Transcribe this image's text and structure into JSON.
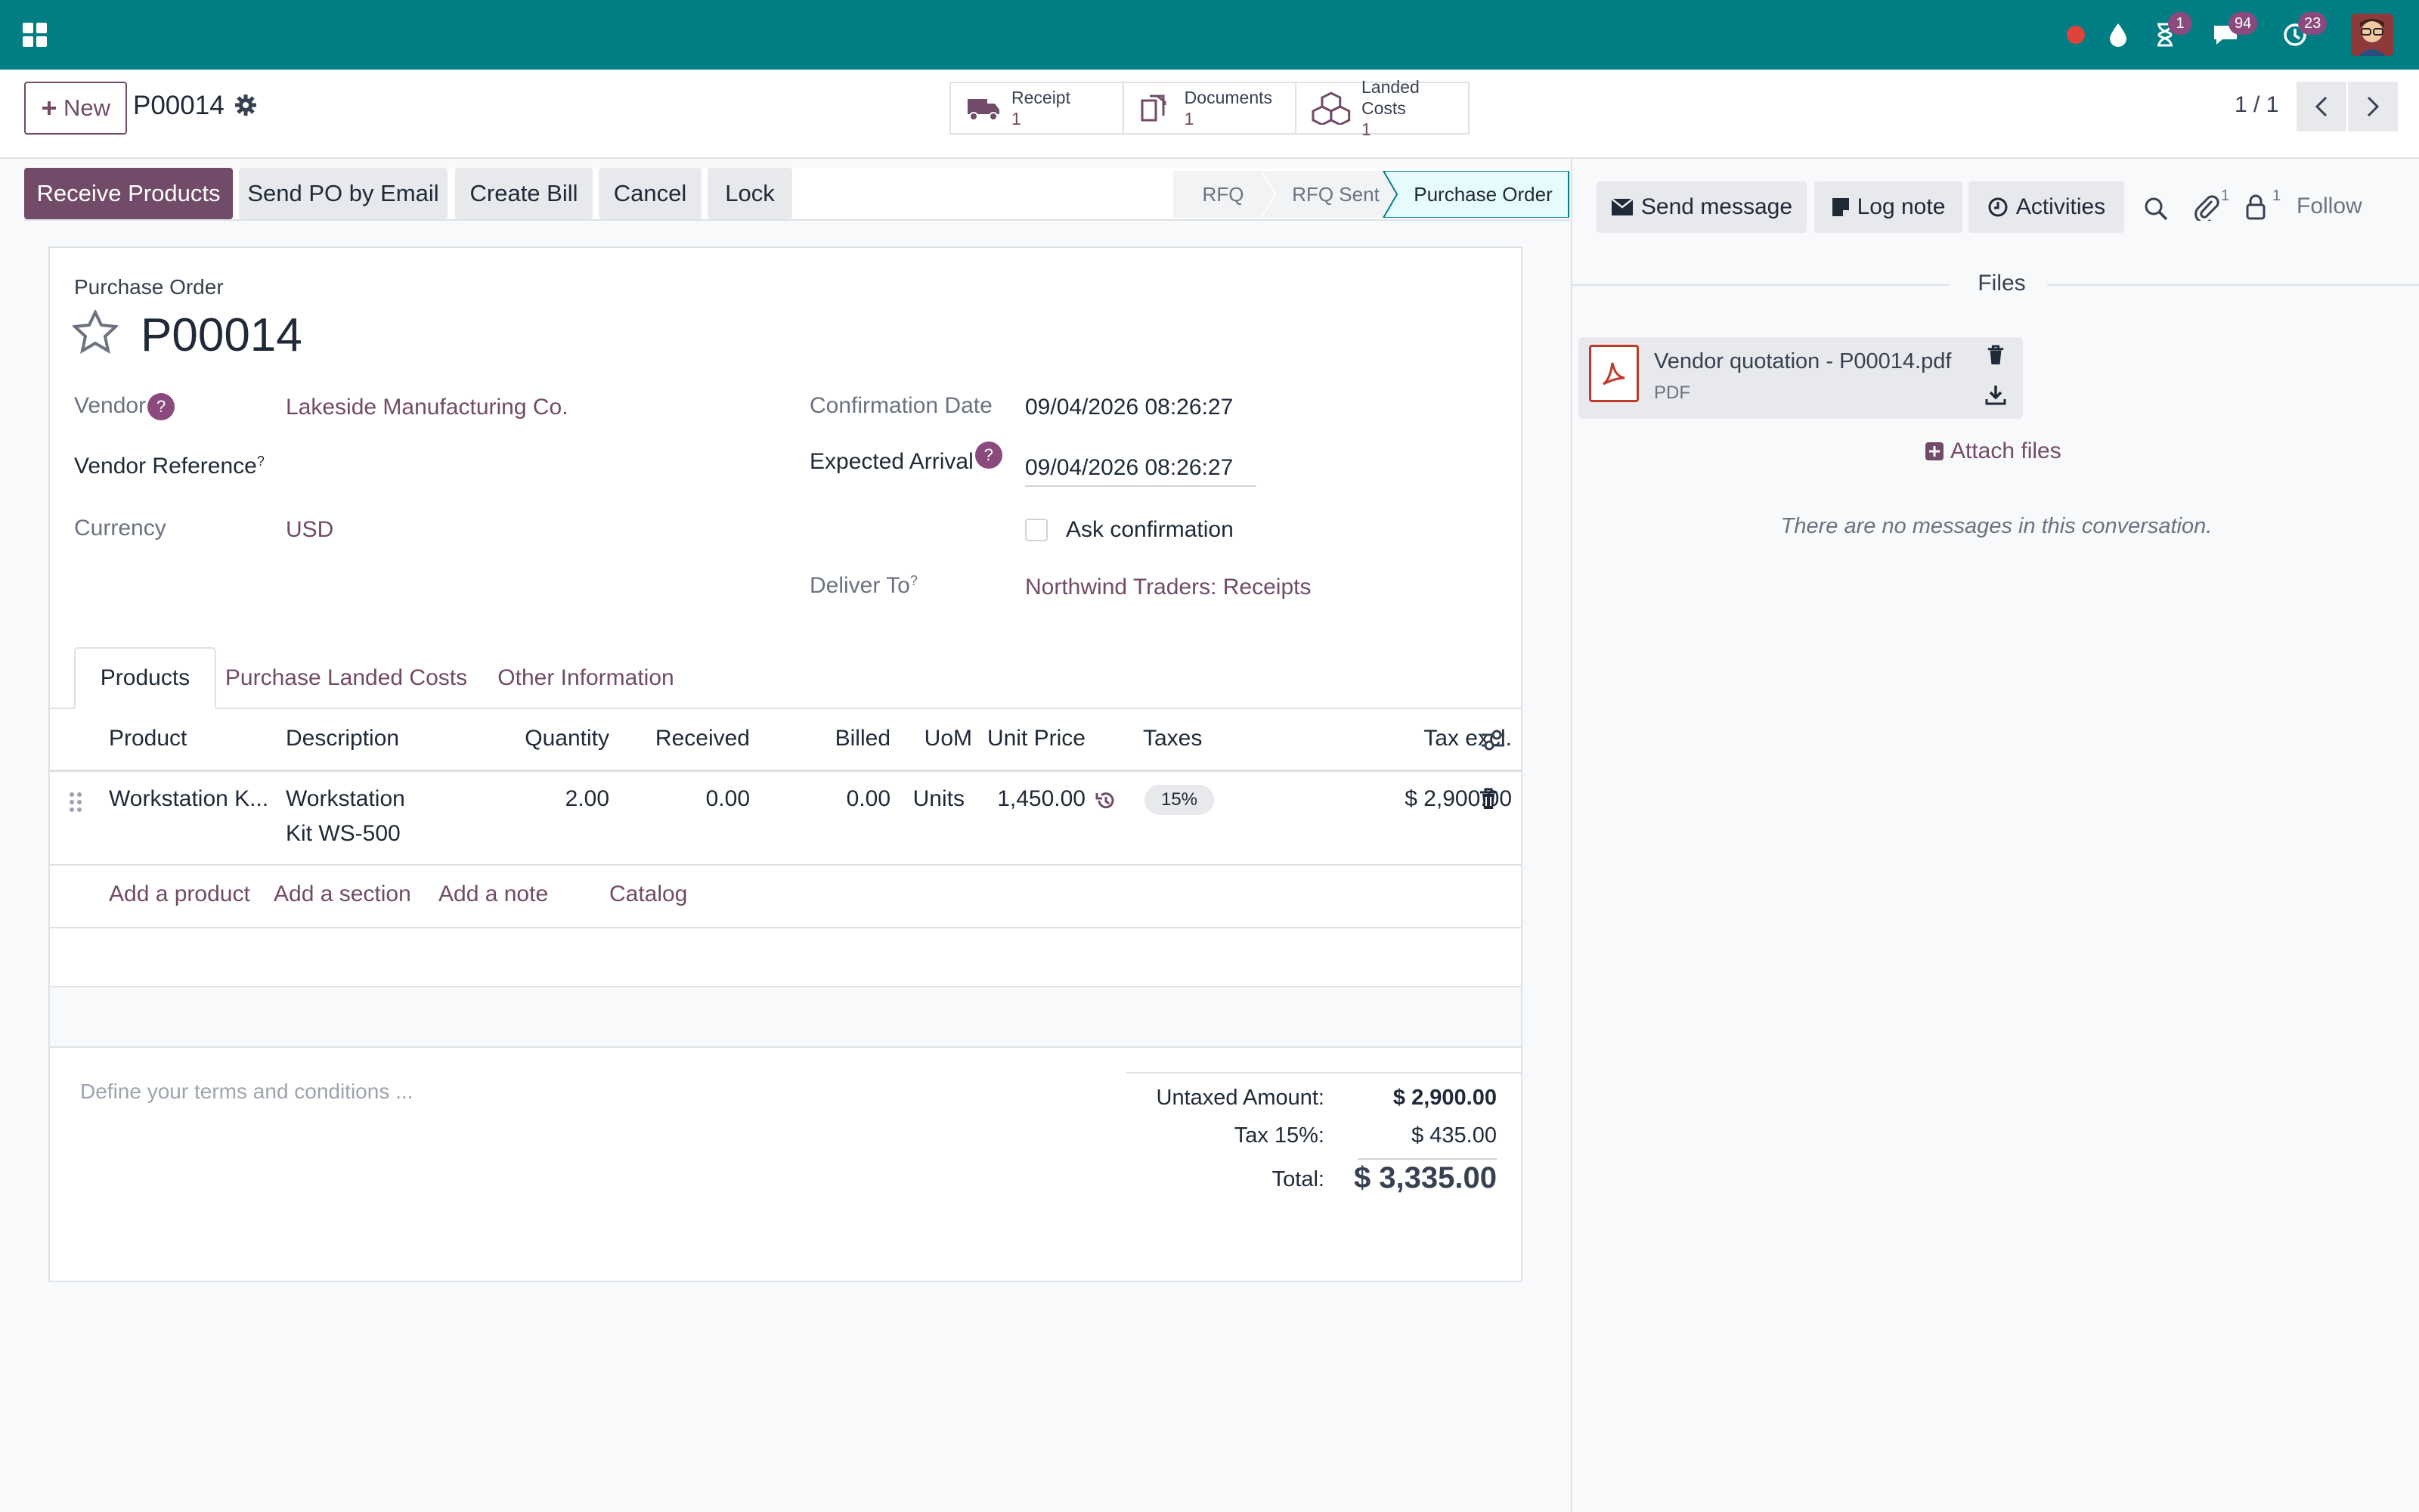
{
  "navbar": {
    "badges": {
      "activities": "1",
      "messages": "94",
      "updates": "23"
    }
  },
  "control_panel": {
    "new_label": "New",
    "record_name": "P00014",
    "pager": "1 / 1",
    "smart_buttons": [
      {
        "label": "Receipt",
        "count": "1"
      },
      {
        "label": "Documents",
        "count": "1"
      },
      {
        "label": "Landed Costs",
        "count": "1"
      }
    ]
  },
  "actions": {
    "receive": "Receive Products",
    "send_email": "Send PO by Email",
    "create_bill": "Create Bill",
    "cancel": "Cancel",
    "lock": "Lock"
  },
  "stages": [
    "RFQ",
    "RFQ Sent",
    "Purchase Order"
  ],
  "form": {
    "type_label": "Purchase Order",
    "name": "P00014",
    "vendor_label": "Vendor",
    "vendor": "Lakeside Manufacturing Co.",
    "vendor_ref_label": "Vendor Reference",
    "currency_label": "Currency",
    "currency": "USD",
    "confirmation_label": "Confirmation Date",
    "confirmation": "09/04/2026 08:26:27",
    "expected_label": "Expected Arrival",
    "expected": "09/04/2026 08:26:27",
    "ask_confirmation": "Ask confirmation",
    "deliver_to_label": "Deliver To",
    "deliver_to": "Northwind Traders: Receipts"
  },
  "tabs": [
    "Products",
    "Purchase Landed Costs",
    "Other Information"
  ],
  "table": {
    "headers": [
      "Product",
      "Description",
      "Quantity",
      "Received",
      "Billed",
      "UoM",
      "Unit Price",
      "Taxes",
      "Tax excl."
    ],
    "rows": [
      {
        "product": "Workstation K...",
        "description_line1": "Workstation",
        "description_line2": "Kit WS-500",
        "quantity": "2.00",
        "received": "0.00",
        "billed": "0.00",
        "uom": "Units",
        "unit_price": "1,450.00",
        "taxes": "15%",
        "subtotal": "$ 2,900.00"
      }
    ],
    "add_product": "Add a product",
    "add_section": "Add a section",
    "add_note": "Add a note",
    "catalog": "Catalog"
  },
  "terms_placeholder": "Define your terms and conditions ...",
  "totals": {
    "untaxed_label": "Untaxed Amount:",
    "untaxed": "$ 2,900.00",
    "tax_label": "Tax 15%:",
    "tax": "$ 435.00",
    "total_label": "Total:",
    "total": "$ 3,335.00"
  },
  "chatter": {
    "send_message": "Send message",
    "log_note": "Log note",
    "activities": "Activities",
    "attachments_count": "1",
    "followers_count": "1",
    "follow": "Follow",
    "files_heading": "Files",
    "file_name": "Vendor quotation - P00014.pdf",
    "file_type": "PDF",
    "attach_files": "Attach files",
    "empty_message": "There are no messages in this conversation."
  },
  "colors": {
    "navbar": "#017e84",
    "primary": "#714b67",
    "badge": "#8a4a7d",
    "active_stage": "#e6fbfb"
  }
}
